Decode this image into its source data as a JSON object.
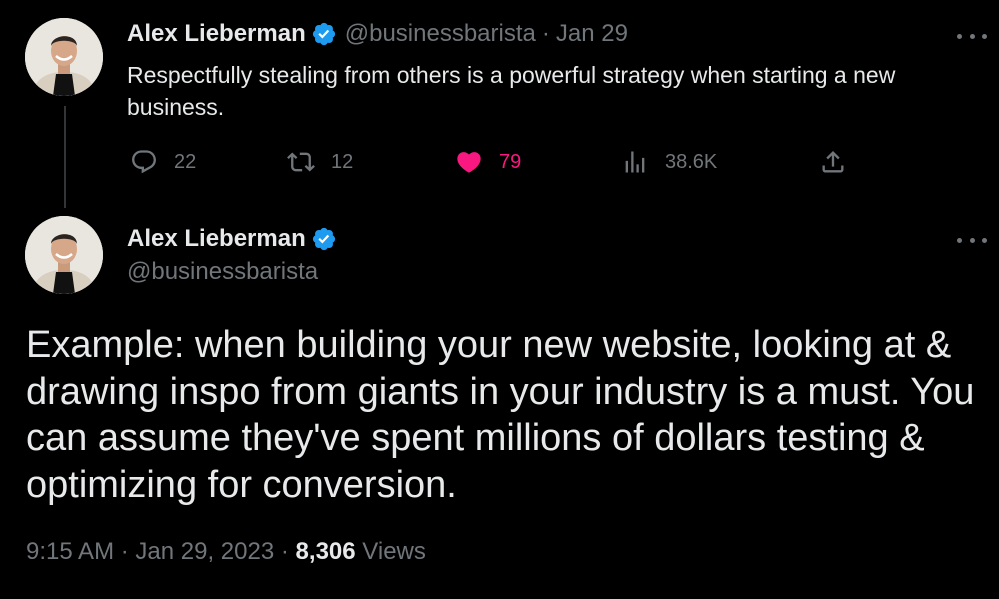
{
  "colors": {
    "background": "#000000",
    "text": "#e7e9ea",
    "muted": "#71767b",
    "verified": "#1d9bf0",
    "like": "#f91880",
    "thread_line": "#333639"
  },
  "tweet1": {
    "author": {
      "name": "Alex Lieberman",
      "handle": "@businessbarista",
      "verified": true,
      "avatar_icon": "profile-photo"
    },
    "separator": "·",
    "date": "Jan 29",
    "text": "Respectfully stealing from others is a powerful strategy when starting a new business.",
    "actions": {
      "replies": {
        "icon": "reply-icon",
        "count": "22"
      },
      "retweets": {
        "icon": "retweet-icon",
        "count": "12"
      },
      "likes": {
        "icon": "heart-icon",
        "count": "79",
        "liked": true
      },
      "views": {
        "icon": "analytics-icon",
        "count": "38.6K"
      },
      "share": {
        "icon": "share-icon"
      }
    }
  },
  "tweet2": {
    "author": {
      "name": "Alex Lieberman",
      "handle": "@businessbarista",
      "verified": true,
      "avatar_icon": "profile-photo"
    },
    "text": "Example: when building your new website, looking at & drawing inspo from giants in your industry is a must. You can assume they've spent millions of dollars testing & optimizing for conversion.",
    "meta": {
      "time": "9:15 AM",
      "separator": "·",
      "date": "Jan 29, 2023",
      "views_count": "8,306",
      "views_label": "Views"
    }
  }
}
